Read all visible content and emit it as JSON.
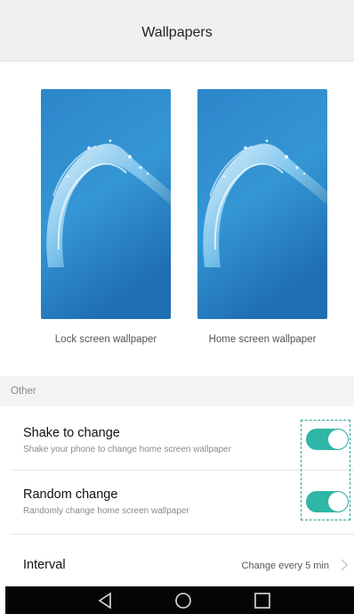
{
  "header": {
    "title": "Wallpapers"
  },
  "wallpapers": {
    "lock_label": "Lock screen wallpaper",
    "home_label": "Home screen wallpaper",
    "preview_image": "blue water splash wallpaper"
  },
  "section": {
    "other_label": "Other"
  },
  "settings": {
    "shake": {
      "title": "Shake to change",
      "subtitle": "Shake your phone to change home screen wallpaper",
      "enabled": true
    },
    "random": {
      "title": "Random change",
      "subtitle": "Randomly change home screen wallpaper",
      "enabled": true
    },
    "interval": {
      "title": "Interval",
      "value": "Change every 5 min"
    }
  },
  "navbar": {
    "icons": [
      "back-triangle-icon",
      "home-circle-icon",
      "recents-square-icon"
    ]
  },
  "colors": {
    "accent": "#2fb6a6",
    "highlight": "#2aa89a",
    "wallpaper_blue": "#2f8fcf"
  }
}
